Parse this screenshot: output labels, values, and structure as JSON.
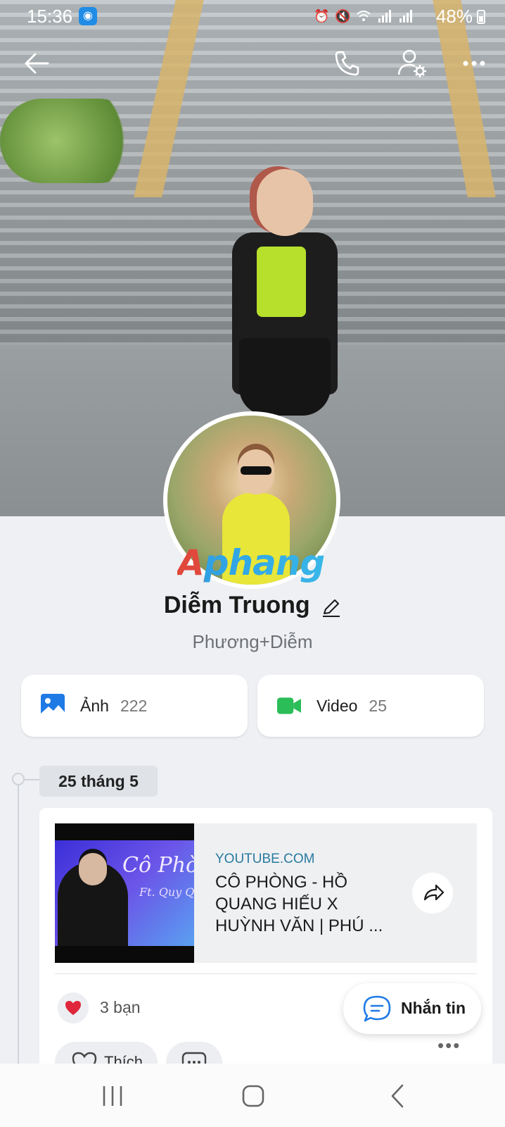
{
  "status_bar": {
    "time": "15:36",
    "battery": "48%",
    "icons": [
      "hotspot-icon",
      "alarm-icon",
      "mute-icon",
      "wifi-icon",
      "signal-icon",
      "signal-icon",
      "battery-icon"
    ]
  },
  "header": {
    "icons": [
      "back-arrow-icon",
      "phone-icon",
      "user-settings-icon",
      "more-icon"
    ]
  },
  "profile": {
    "name": "Diễm Truong",
    "subtitle": "Phương+Diễm",
    "watermark": "Aphang"
  },
  "media": [
    {
      "label": "Ảnh",
      "count": "222",
      "icon": "image-icon",
      "color": "#1f7ae6"
    },
    {
      "label": "Video",
      "count": "25",
      "icon": "video-camera-icon",
      "color": "#2bbd58"
    }
  ],
  "timeline": {
    "date": "25 tháng 5"
  },
  "post": {
    "link_domain": "YOUTUBE.COM",
    "link_title": "CÔ PHÒNG - HỒ QUANG HIẾU X HUỲNH VĂN | PHÚ ...",
    "thumbnail_text": "Cô Phòng",
    "thumbnail_subtext": "Ft. Quy Quang",
    "reaction_count": "3 bạn",
    "like_label": "Thích"
  },
  "message_button": {
    "label": "Nhắn tin"
  },
  "colors": {
    "accent": "#1f7ae6",
    "video_green": "#2bbd58",
    "link_blue": "#2a7aa0",
    "heart_red": "#e0263b"
  }
}
